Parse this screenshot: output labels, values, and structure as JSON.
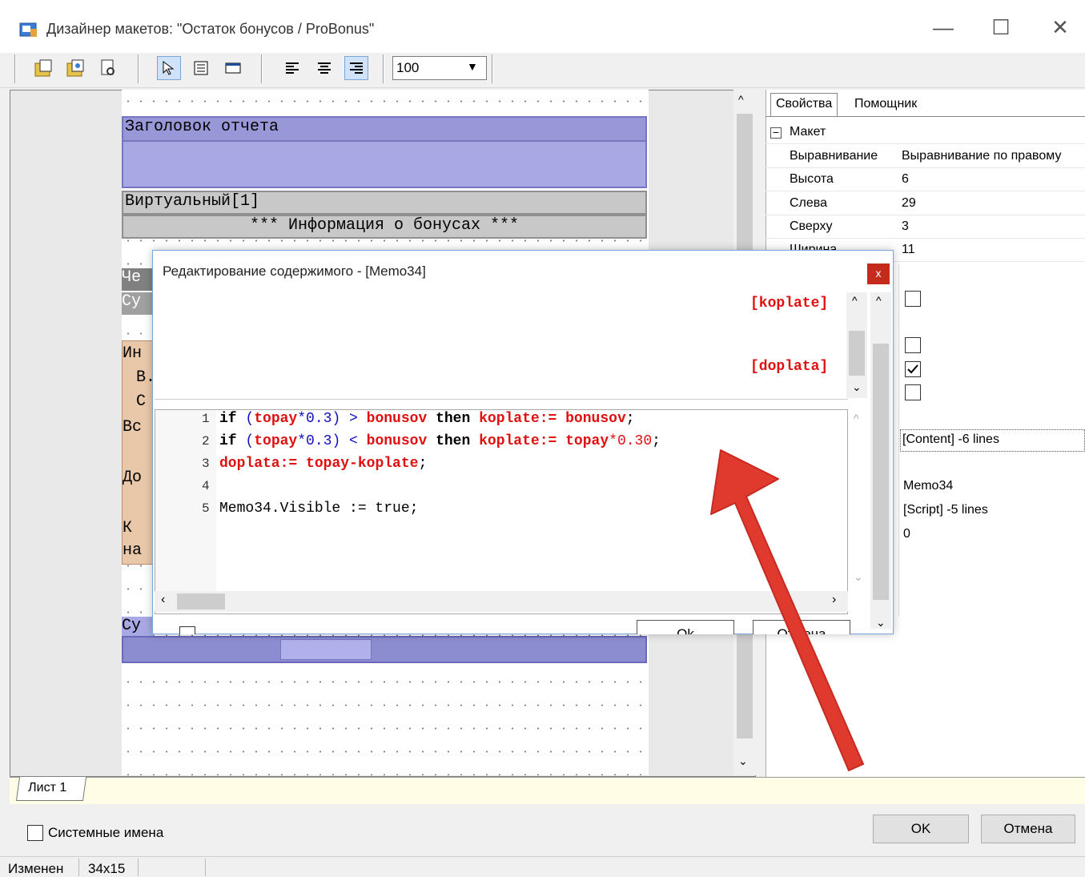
{
  "window": {
    "title": "Дизайнер макетов: \"Остаток бонусов / ProBonus\""
  },
  "toolbar": {
    "zoom_value": "100"
  },
  "canvas": {
    "band_report_title": "Заголовок отчета",
    "band_virtual": "Виртуальный[1]",
    "band_info_text": "*** Информация о бонусах ***",
    "hidden_prefixes": [
      "Чe",
      "Cy",
      "Ин",
      "В.",
      "С",
      "Вс",
      "До",
      "К",
      "на",
      "Су"
    ]
  },
  "properties": {
    "tab_properties": "Свойства",
    "tab_helper": "Помощник",
    "group_layout": "Макет",
    "rows": [
      {
        "name": "Выравнивание",
        "value": "Выравнивание по правому"
      },
      {
        "name": "Высота",
        "value": "6"
      },
      {
        "name": "Слева",
        "value": "29"
      },
      {
        "name": "Сверху",
        "value": "3"
      },
      {
        "name": "Ширина",
        "value": "11"
      }
    ],
    "content_value": "[Content] -6 lines",
    "name_value": "Memo34",
    "script_value": "[Script] -5 lines",
    "zero_value": "0"
  },
  "dialog": {
    "title": "Редактирование содержимого - [Memo34]",
    "close_label": "x",
    "preview_line1": "[koplate]",
    "preview_line2": "[doplata]",
    "line_numbers": [
      "1",
      "2",
      "3",
      "4",
      "5"
    ],
    "code": {
      "l1_if": "if",
      "l1_open": " (",
      "l1_topay": "topay",
      "l1_mul": "*0.3)",
      "l1_gt": " > ",
      "l1_bonusov": "bonusov",
      "l1_then": " then ",
      "l1_koplate": "koplate",
      "l1_assign": ":=",
      "l1_bonusov2": " bonusov",
      "l1_end": ";",
      "l2_if": "if",
      "l2_open": " (",
      "l2_topay": "topay",
      "l2_mul": "*0.3)",
      "l2_lt": " < ",
      "l2_bonusov": "bonusov",
      "l2_then": " then ",
      "l2_koplate": "koplate",
      "l2_assign": ":=",
      "l2_topay2": " topay",
      "l2_num": "*0.30",
      "l2_end": ";",
      "l3_doplata": "doplata",
      "l3_assign": ":=",
      "l3_expr": " topay-koplate",
      "l3_end": ";",
      "l5_text": "Memo34.Visible := true;"
    },
    "ok_partial": "Ok",
    "cancel_partial": "Отмена"
  },
  "sheet_tab": "Лист 1",
  "footer": {
    "system_names_label": "Системные имена",
    "ok_label": "OK",
    "cancel_label": "Отмена"
  },
  "status": {
    "state": "Изменен",
    "size": "34x15"
  },
  "colors": {
    "band_blue": "#a8a8e4",
    "band_gray": "#c8c8c8",
    "band_tan": "#e8c8a8",
    "code_red": "#e01010",
    "arrow_red": "#e03a2e"
  }
}
